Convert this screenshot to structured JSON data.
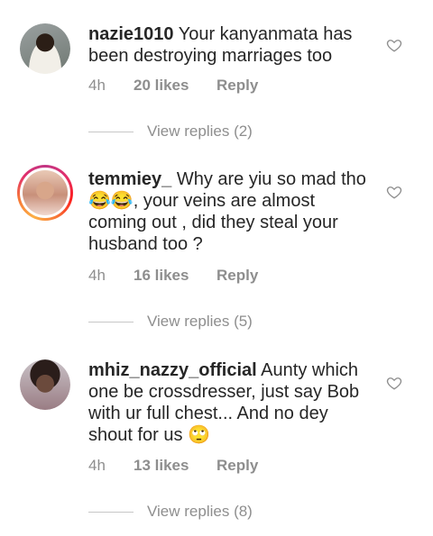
{
  "comments": [
    {
      "username": "nazie1010",
      "text": " Your kanyanmata has been destroying marriages too",
      "time": "4h",
      "likes": "20 likes",
      "reply": "Reply",
      "view_replies": "View replies (2)"
    },
    {
      "username": "temmiey_",
      "text": " Why are yiu so mad tho 😂😂, your veins are almost coming out , did they steal your husband too ?",
      "time": "4h",
      "likes": "16 likes",
      "reply": "Reply",
      "view_replies": "View replies (5)"
    },
    {
      "username": "mhiz_nazzy_official",
      "text": " Aunty which one be crossdresser, just say Bob with ur full chest... And no dey shout for us 🙄",
      "time": "4h",
      "likes": "13 likes",
      "reply": "Reply",
      "view_replies": "View replies (8)"
    }
  ],
  "icons": {
    "like": "heart-outline-icon"
  },
  "colors": {
    "text": "#262626",
    "secondary": "#8e8e8e",
    "divider": "#c7c7c7"
  }
}
